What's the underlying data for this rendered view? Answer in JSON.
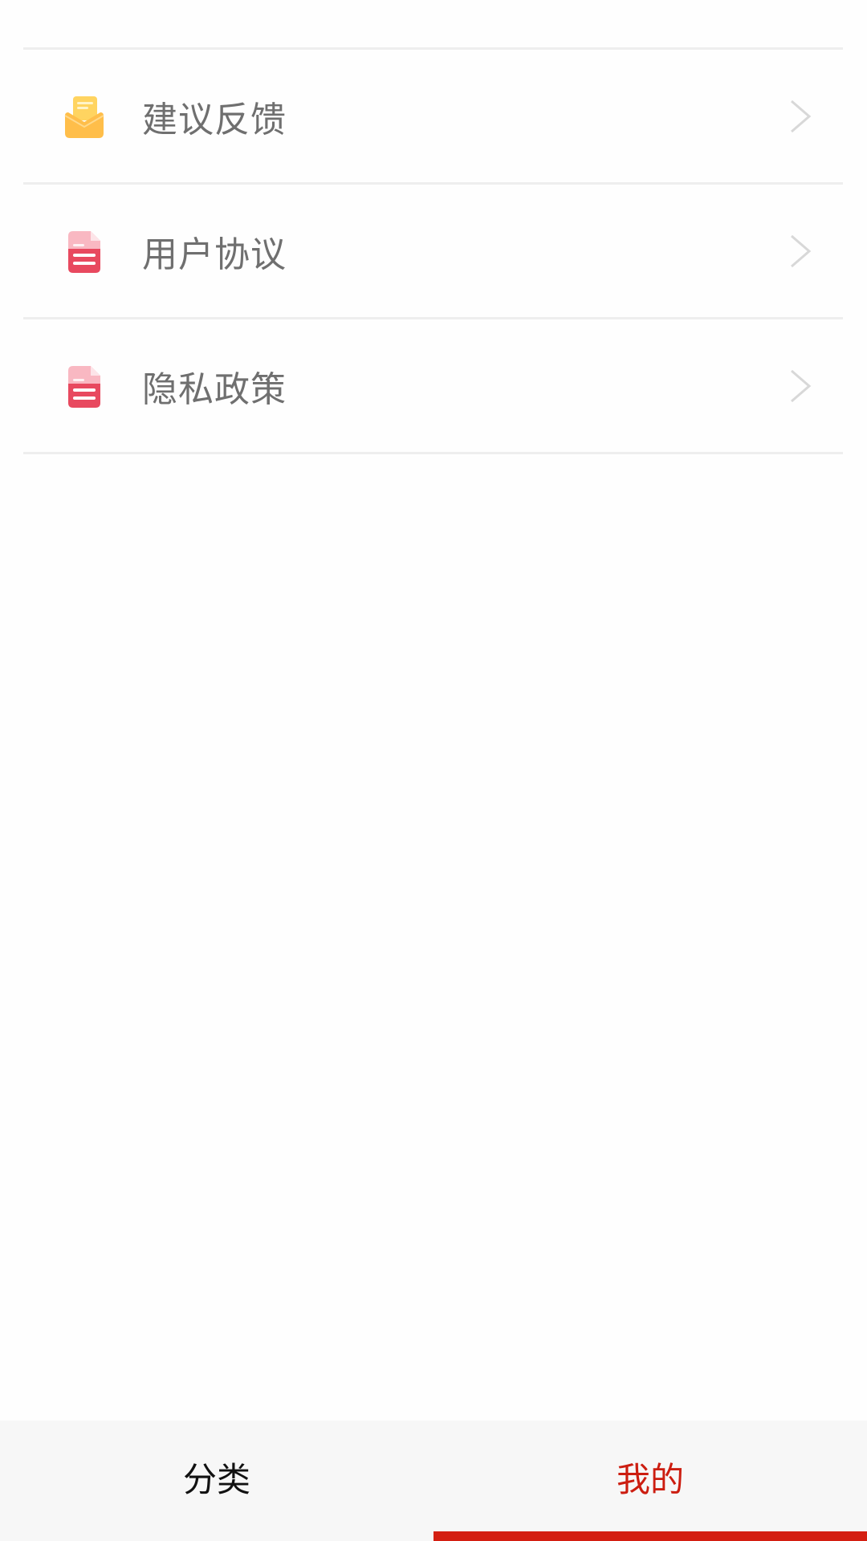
{
  "menu": {
    "items": [
      {
        "label": "建议反馈",
        "icon": "envelope-open-icon"
      },
      {
        "label": "用户协议",
        "icon": "document-icon"
      },
      {
        "label": "隐私政策",
        "icon": "document-icon"
      }
    ]
  },
  "tab_bar": {
    "tabs": [
      {
        "label": "分类",
        "active": false
      },
      {
        "label": "我的",
        "active": true
      }
    ]
  },
  "colors": {
    "accent": "#d41f12",
    "envelope_icon": "#ffbe4a",
    "document_icon": "#e8495f",
    "label_text": "#6f6f6f",
    "divider": "#eeeeee"
  }
}
